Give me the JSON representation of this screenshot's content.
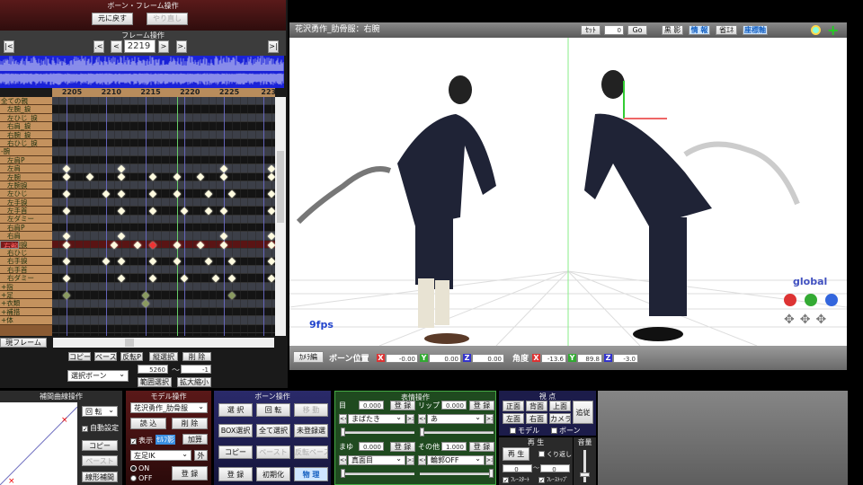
{
  "left_panel": {
    "title": "ボーン・フレーム操作",
    "undo": "元に戻す",
    "redo": "やり直し",
    "frame_ops_title": "フレーム操作",
    "current_frame": "2219",
    "nav": {
      "first": "|<",
      "prev_key": ".<",
      "prev": "<",
      "next": ">",
      "next_key": ">.",
      "last": ">|"
    },
    "ruler_ticks": [
      "2205",
      "2210",
      "2215",
      "2220",
      "2225",
      "223"
    ],
    "current_frame_number": 2219,
    "first_frame": 2205,
    "frames_per_tick": 5,
    "tracks": [
      {
        "label": "全ての親",
        "group": true,
        "keys": []
      },
      {
        "label": "左腕_捩",
        "keys": []
      },
      {
        "label": "左ひじ_捩",
        "keys": []
      },
      {
        "label": "右肩_捩",
        "keys": []
      },
      {
        "label": "右腕_捩",
        "keys": []
      },
      {
        "label": "右ひじ_捩",
        "keys": []
      },
      {
        "label": "-腕",
        "group": true,
        "keys": []
      },
      {
        "label": "左肩P",
        "keys": []
      },
      {
        "label": "左肩",
        "keys": [
          2205,
          2212,
          2225,
          2231
        ]
      },
      {
        "label": "左腕",
        "keys": [
          2205,
          2208,
          2212,
          2216,
          2219,
          2222,
          2225,
          2231
        ]
      },
      {
        "label": "左腕捩",
        "keys": []
      },
      {
        "label": "左ひじ",
        "keys": [
          2205,
          2210,
          2212,
          2216,
          2219,
          2223,
          2226,
          2231
        ]
      },
      {
        "label": "左手捩",
        "keys": []
      },
      {
        "label": "左手首",
        "keys": [
          2205,
          2212,
          2216,
          2220,
          2223,
          2225,
          2231
        ]
      },
      {
        "label": "左ダミー",
        "keys": []
      },
      {
        "label": "右肩P",
        "keys": []
      },
      {
        "label": "右肩",
        "keys": [
          2205,
          2212,
          2225,
          2231
        ]
      },
      {
        "label": "右腕",
        "selected": true,
        "selected_key": 2216,
        "keys": [
          2205,
          2211,
          2214,
          2216,
          2219,
          2222,
          2225,
          2231
        ]
      },
      {
        "label": "右腕捩",
        "keys": []
      },
      {
        "label": "右ひじ",
        "keys": [
          2205,
          2210,
          2212,
          2216,
          2219,
          2223,
          2226,
          2231
        ]
      },
      {
        "label": "右手捩",
        "keys": []
      },
      {
        "label": "右手首",
        "keys": [
          2205,
          2212,
          2216,
          2220,
          2224,
          2226,
          2231
        ]
      },
      {
        "label": "右ダミー",
        "keys": []
      },
      {
        "label": "+指",
        "group": true,
        "olive": true,
        "keys": [
          2205,
          2215,
          2226
        ]
      },
      {
        "label": "+足",
        "group": true,
        "olive": true,
        "keys": [
          2215
        ]
      },
      {
        "label": "+衣類",
        "group": true,
        "keys": []
      },
      {
        "label": "+補措",
        "group": true,
        "keys": []
      },
      {
        "label": "+体",
        "group": true,
        "keys": []
      }
    ],
    "current_frame_button": "現フレーム",
    "copy": "コピー",
    "paste": "ペースト",
    "flip_paste": "反転P",
    "vertical_select": "縦選択",
    "delete": "削 除",
    "select_mode": "選択ボーン",
    "range_from": "5260",
    "range_tilde": "〜",
    "range_to": "-1",
    "range_select": "範囲選択",
    "zoom": "拡大縮小"
  },
  "viewport": {
    "title": "花沢勇作_肋骨服：右腕",
    "set": "ｾｯﾄ",
    "frame_input": "0",
    "go": "Go",
    "shadow": "黒 影",
    "info": "情 報",
    "eco": "省ｴﾈ",
    "axis": "座標軸",
    "fps": "9fps",
    "mode": "global",
    "camera_edit": "ｶﾒﾗ編",
    "bone_pos_label": "ボーン位置",
    "angle_label": "角度",
    "pos": {
      "x": "-0.00",
      "y": "0.00",
      "z": "0.00"
    },
    "rot": {
      "x": "-13.6",
      "y": "89.8",
      "z": "-3.0"
    },
    "axis_letters": {
      "x": "X",
      "y": "Y",
      "z": "Z"
    }
  },
  "interp_panel": {
    "title": "補間曲線操作",
    "type": "回 転",
    "auto": "自動設定",
    "copy": "コピー",
    "paste": "ペースト",
    "linear": "線形補間"
  },
  "model_panel": {
    "title": "モデル操作",
    "model": "花沢勇作_肋骨服",
    "load": "読 込",
    "delete": "削 除",
    "show": "表示",
    "self_shadow": "ｾﾙﾌ影",
    "add": "加算",
    "bone": "左足IK",
    "outside": "外",
    "on": "ON",
    "off": "OFF",
    "register": "登 録"
  },
  "bone_panel": {
    "title": "ボーン操作",
    "select": "選 択",
    "rotate": "回 転",
    "move": "移 動",
    "box_select": "BOX選択",
    "select_all": "全て選択",
    "unregistered": "未登録選",
    "copy": "コピー",
    "paste": "ペースト",
    "flip_paste": "反転ペースト",
    "register": "登 録",
    "reset": "初期化",
    "physics": "物 理"
  },
  "morph_panel": {
    "title": "表情操作",
    "eye": {
      "label": "目",
      "value": "0.000",
      "register": "登 録",
      "morph": "まばたき"
    },
    "lip": {
      "label": "リップ",
      "value": "0.000",
      "register": "登 録",
      "morph": "あ"
    },
    "brow": {
      "label": "まゆ",
      "value": "0.000",
      "register": "登 録",
      "morph": "真面目"
    },
    "other": {
      "label": "その他",
      "value": "1.000",
      "register": "登 録",
      "morph": "輪郭OFF"
    },
    "prev": "<<",
    "next": ">>"
  },
  "view_panel": {
    "title": "視 点",
    "front": "正面",
    "back": "背面",
    "top": "上面",
    "left": "左面",
    "right": "右面",
    "camera": "カメラ",
    "follow": "追従",
    "model": "モデル",
    "bone": "ボーン"
  },
  "play_panel": {
    "title": "再 生",
    "play": "再 生",
    "repeat": "くり返し",
    "from": "0",
    "to": "0",
    "tilde": "〜",
    "frame_start": "ﾌﾚｰｽﾀｰﾄ",
    "frame_stop": "ﾌﾚｰｽﾄｯﾌﾟ"
  },
  "volume_panel": {
    "title": "音量",
    "level": 0.2
  }
}
